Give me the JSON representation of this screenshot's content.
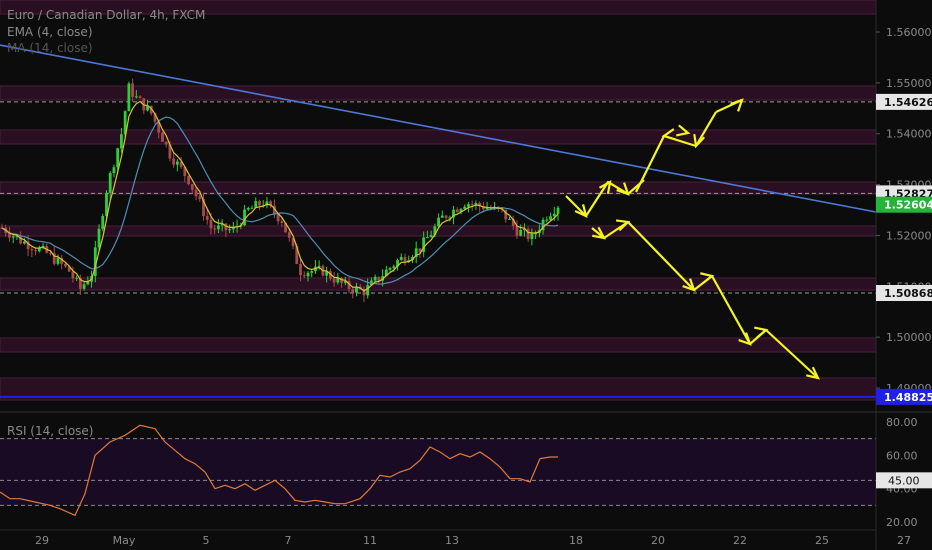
{
  "legend": {
    "title": "Euro / Canadian Dollar, 4h, FXCM",
    "ema": "EMA (4, close)",
    "ma": "MA (14, close)",
    "rsi": "RSI (14, close)"
  },
  "colors": {
    "background": "#0c0c0c",
    "bull_candle": "#2fcf35",
    "bear_candle": "#a94a4a",
    "ema_line": "#d8c23a",
    "ma_line": "#4f8fb4",
    "trendline": "#4e78d6",
    "support_line": "#1f1fe6",
    "projection_arrows": "#f4f41f",
    "rsi_line": "#e07a3a",
    "zone_fill": "#2a0f22",
    "tag_grey": "#e6e6e6",
    "tag_green": "#25b33a",
    "tag_blue": "#1f1fe6"
  },
  "price_axis": {
    "ticks": [
      "1.56000",
      "1.55000",
      "1.54000",
      "1.53000",
      "1.52000",
      "1.51000",
      "1.50000",
      "1.49000"
    ],
    "tags": [
      {
        "label": "1.54626",
        "kind": "grey"
      },
      {
        "label": "1.52827",
        "kind": "grey"
      },
      {
        "label": "1.52604",
        "kind": "green"
      },
      {
        "label": "1.50868",
        "kind": "grey"
      },
      {
        "label": "1.48825",
        "kind": "blue"
      }
    ]
  },
  "rsi_axis": {
    "ticks": [
      "80.00",
      "60.00",
      "40.00",
      "20.00"
    ],
    "tag": "45.00"
  },
  "time_axis": {
    "ticks": [
      "29",
      "May",
      "5",
      "7",
      "11",
      "13",
      "18",
      "20",
      "22",
      "25",
      "27"
    ]
  },
  "chart_data": {
    "type": "candlestick",
    "symbol": "Euro / Canadian Dollar",
    "timeframe": "4h",
    "current_price": 1.52604,
    "levels": [
      1.54626,
      1.52827,
      1.50868,
      1.48825
    ],
    "ylim": [
      1.482,
      1.565
    ],
    "rsi_reference_levels": [
      70,
      45,
      30
    ],
    "rsi_last": 60
  }
}
